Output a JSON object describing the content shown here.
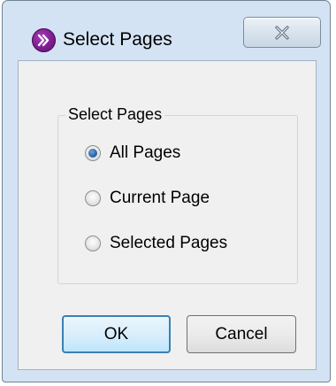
{
  "window": {
    "title": "Select Pages",
    "icon": "app-icon",
    "close_icon": "close-icon"
  },
  "group": {
    "legend": "Select Pages",
    "options": [
      {
        "label": "All Pages",
        "checked": true
      },
      {
        "label": "Current Page",
        "checked": false
      },
      {
        "label": "Selected Pages",
        "checked": false
      }
    ]
  },
  "buttons": {
    "ok_label": "OK",
    "cancel_label": "Cancel"
  }
}
